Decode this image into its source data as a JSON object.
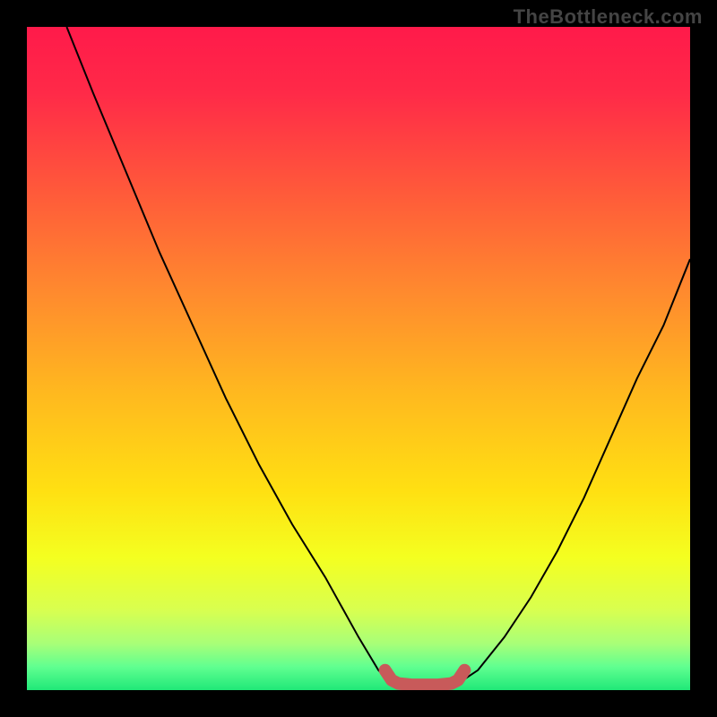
{
  "watermark": "TheBottleneck.com",
  "chart_data": {
    "type": "line",
    "title": "",
    "xlabel": "",
    "ylabel": "",
    "xlim": [
      0,
      100
    ],
    "ylim": [
      0,
      100
    ],
    "grid": false,
    "legend": false,
    "series": [
      {
        "name": "left-curve",
        "x": [
          6,
          10,
          15,
          20,
          25,
          30,
          35,
          40,
          45,
          50,
          53,
          55
        ],
        "values": [
          100,
          90,
          78,
          66,
          55,
          44,
          34,
          25,
          17,
          8,
          3,
          1
        ]
      },
      {
        "name": "right-curve",
        "x": [
          65,
          68,
          72,
          76,
          80,
          84,
          88,
          92,
          96,
          100
        ],
        "values": [
          1,
          3,
          8,
          14,
          21,
          29,
          38,
          47,
          55,
          65
        ]
      },
      {
        "name": "bottom-marker",
        "x": [
          54,
          55,
          56,
          58,
          60,
          62,
          64,
          65,
          66
        ],
        "values": [
          3,
          1.5,
          1,
          0.8,
          0.8,
          0.8,
          1,
          1.5,
          3
        ],
        "style": "thick-red"
      }
    ],
    "background_gradient": {
      "stops": [
        {
          "offset": 0.0,
          "color": "#ff1a4a"
        },
        {
          "offset": 0.1,
          "color": "#ff2a48"
        },
        {
          "offset": 0.25,
          "color": "#ff5a3a"
        },
        {
          "offset": 0.4,
          "color": "#ff8a2e"
        },
        {
          "offset": 0.55,
          "color": "#ffb81f"
        },
        {
          "offset": 0.7,
          "color": "#ffe012"
        },
        {
          "offset": 0.8,
          "color": "#f4ff20"
        },
        {
          "offset": 0.88,
          "color": "#d8ff50"
        },
        {
          "offset": 0.93,
          "color": "#a8ff78"
        },
        {
          "offset": 0.965,
          "color": "#60ff90"
        },
        {
          "offset": 1.0,
          "color": "#20e878"
        }
      ]
    }
  }
}
